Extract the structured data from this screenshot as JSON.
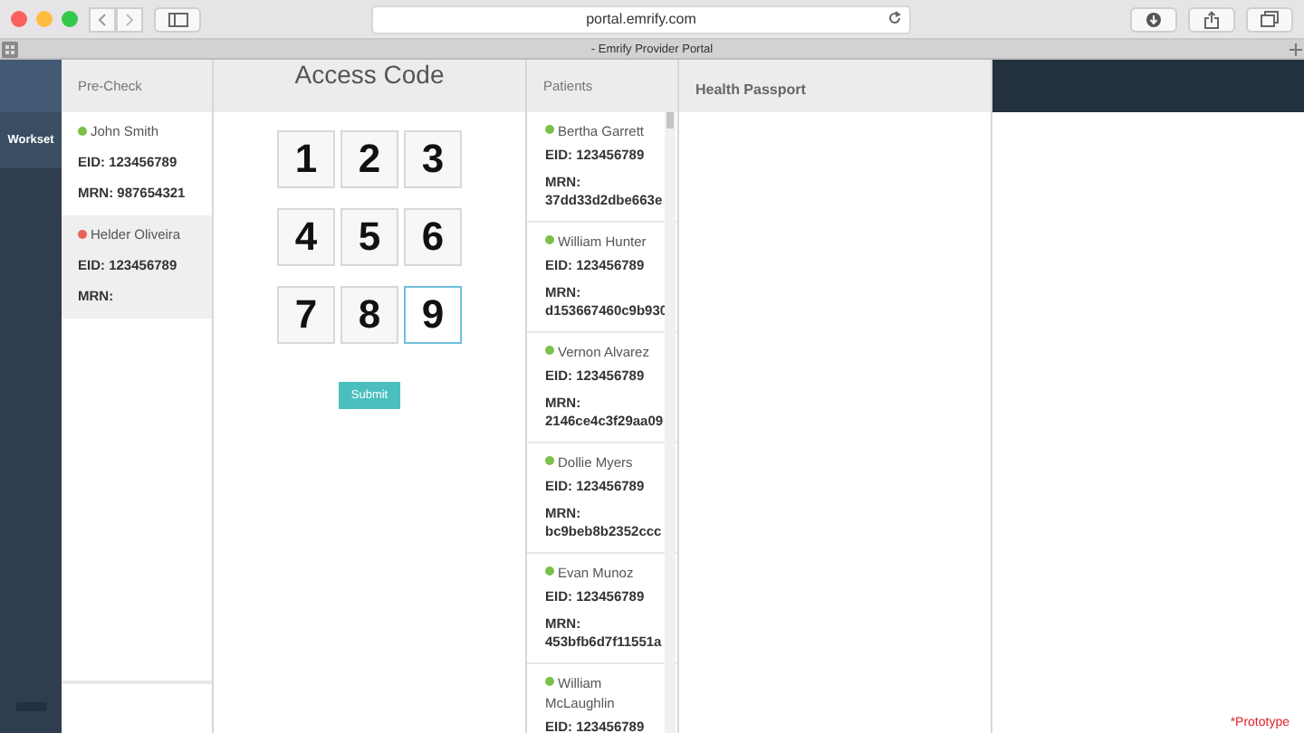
{
  "browser": {
    "url": "portal.emrify.com",
    "tab_title": "- Emrify Provider Portal"
  },
  "sidebar": {
    "items": [
      {
        "label": "Workset",
        "selected": true
      }
    ]
  },
  "precheck": {
    "title": "Pre-Check",
    "patients": [
      {
        "name": "John Smith",
        "color": "#7cc04b",
        "eid": "EID: 123456789",
        "mrn": "MRN: 987654321",
        "selected": false
      },
      {
        "name": "Helder Oliveira",
        "color": "#e8635a",
        "eid": "EID: 123456789",
        "mrn": "MRN:",
        "selected": true
      }
    ]
  },
  "access_code": {
    "title": "Access Code",
    "keys": [
      {
        "value": "1",
        "focused": false
      },
      {
        "value": "2",
        "focused": false
      },
      {
        "value": "3",
        "focused": false
      },
      {
        "value": "4",
        "focused": false
      },
      {
        "value": "5",
        "focused": false
      },
      {
        "value": "6",
        "focused": false
      },
      {
        "value": "7",
        "focused": false
      },
      {
        "value": "8",
        "focused": false
      },
      {
        "value": "9",
        "focused": true
      }
    ],
    "submit": "Submit"
  },
  "patients": {
    "title": "Patients",
    "items": [
      {
        "name": "Bertha Garrett",
        "color": "#7cc04b",
        "eid": "EID: 123456789",
        "mrn_label": "MRN:",
        "mrn": "37dd33d2dbe663e"
      },
      {
        "name": "William Hunter",
        "color": "#7cc04b",
        "eid": "EID: 123456789",
        "mrn_label": "MRN:",
        "mrn": "d153667460c9b930"
      },
      {
        "name": "Vernon Alvarez",
        "color": "#7cc04b",
        "eid": "EID: 123456789",
        "mrn_label": "MRN:",
        "mrn": "2146ce4c3f29aa09"
      },
      {
        "name": "Dollie Myers",
        "color": "#7cc04b",
        "eid": "EID: 123456789",
        "mrn_label": "MRN:",
        "mrn": "bc9beb8b2352ccc"
      },
      {
        "name": "Evan Munoz",
        "color": "#7cc04b",
        "eid": "EID: 123456789",
        "mrn_label": "MRN:",
        "mrn": "453bfb6d7f11551a"
      },
      {
        "name": "William McLaughlin",
        "color": "#7cc04b",
        "eid": "EID: 123456789"
      }
    ]
  },
  "health_passport": {
    "title": "Health Passport"
  },
  "footer_note": "*Prototype"
}
